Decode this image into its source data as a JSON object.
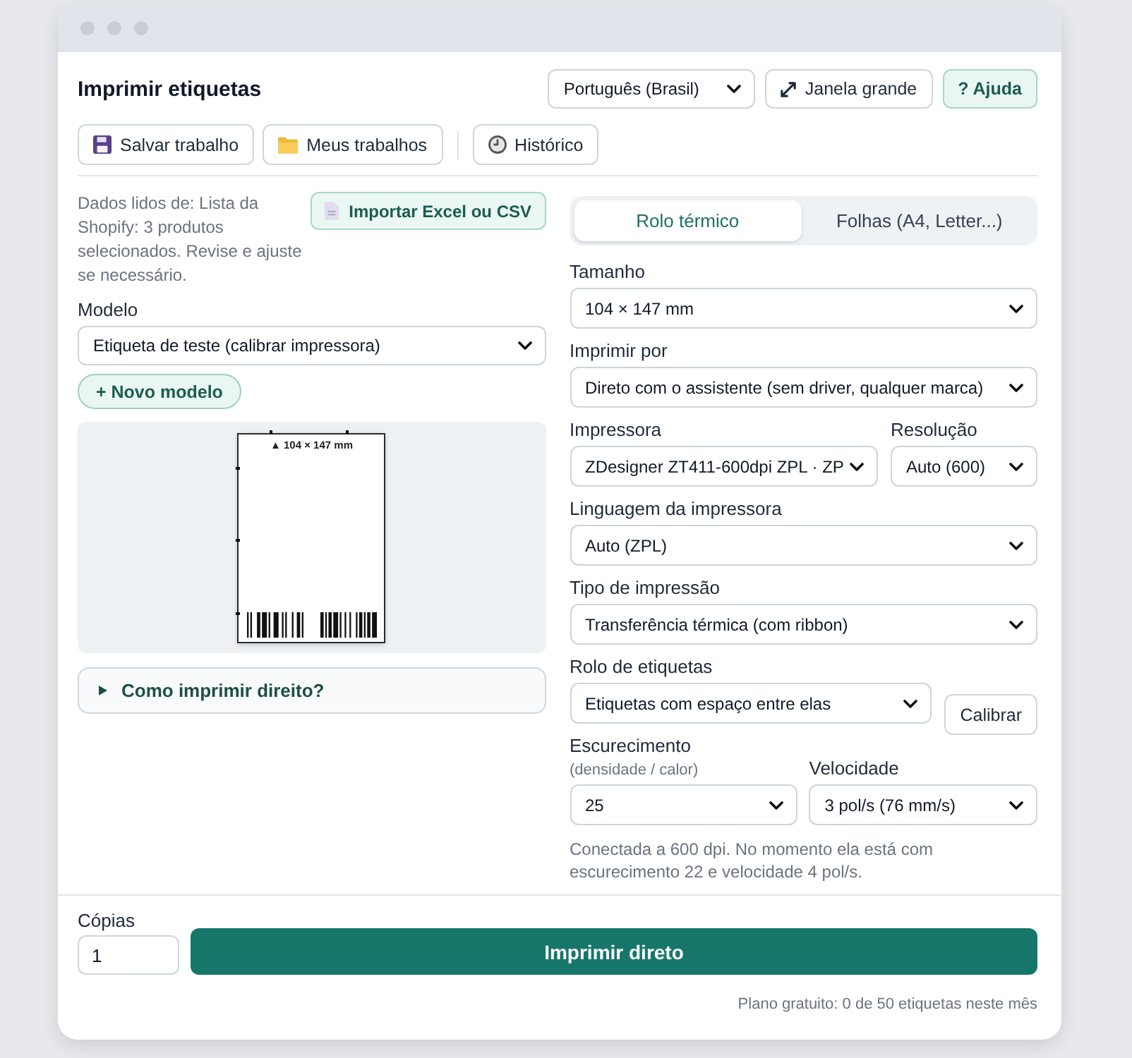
{
  "header": {
    "title": "Imprimir etiquetas",
    "language": {
      "value": "Português (Brasil)"
    },
    "buttons": [
      {
        "label": "Janela grande",
        "kind": "expand"
      },
      {
        "label": "? Ajuda",
        "kind": "help"
      }
    ]
  },
  "toolbar": {
    "groups": [
      [
        {
          "label": "Salvar trabalho",
          "kind": "save"
        },
        {
          "label": "Meus trabalhos",
          "kind": "folder"
        }
      ],
      [
        {
          "label": "Histórico",
          "kind": "history"
        }
      ]
    ]
  },
  "source_panel": {
    "note": "Dados lidos de: Lista da Shopify: 3 produtos selecionados. Revise e ajuste se necessário.",
    "import_button": "Importar Excel ou CSV",
    "model": {
      "label": "Modelo",
      "value": "Etiqueta de teste (calibrar impressora)"
    },
    "new_model_button": "+ Novo modelo",
    "preview": {
      "caption": "▲ 104 × 147 mm"
    },
    "help": {
      "label": "Como imprimir direito?",
      "expanded": false
    }
  },
  "printer_panel": {
    "tabs": [
      {
        "label": "Rolo térmico",
        "selected": true
      },
      {
        "label": "Folhas (A4, Letter...)",
        "selected": false
      }
    ],
    "rows": [
      {
        "kind": "single",
        "fields": [
          {
            "label": "Tamanho",
            "value": "104 × 147 mm"
          }
        ]
      },
      {
        "kind": "single",
        "fields": [
          {
            "label": "Imprimir por",
            "value": "Direto com o assistente (sem driver, qualquer marca)"
          }
        ]
      },
      {
        "kind": "lopsided",
        "fields": [
          {
            "label": "Impressora",
            "value": "ZDesigner ZT411-600dpi ZPL · ZP"
          },
          {
            "label": "Resolução",
            "value": "Auto (600)"
          }
        ]
      },
      {
        "kind": "single",
        "fields": [
          {
            "label": "Linguagem da impressora",
            "value": "Auto (ZPL)"
          }
        ]
      },
      {
        "kind": "single",
        "fields": [
          {
            "label": "Tipo de impressão",
            "value": "Transferência térmica (com ribbon)"
          }
        ]
      },
      {
        "kind": "action",
        "fields": [
          {
            "label": "Rolo de etiquetas",
            "value": "Etiquetas com espaço entre elas"
          }
        ],
        "button": "Calibrar"
      },
      {
        "kind": "even",
        "fields": [
          {
            "label": "Escurecimento",
            "hint": "(densidade / calor)",
            "value": "25"
          },
          {
            "label": "Velocidade",
            "value": "3 pol/s (76 mm/s)"
          }
        ]
      }
    ],
    "status_note": "Conectada a 600 dpi. No momento ela está com escurecimento 22 e velocidade 4 pol/s."
  },
  "footer": {
    "copies": {
      "label": "Cópias",
      "value": "1"
    },
    "print_button": "Imprimir direto",
    "plan_note": "Plano gratuito: 0 de 50 etiquetas neste mês"
  }
}
